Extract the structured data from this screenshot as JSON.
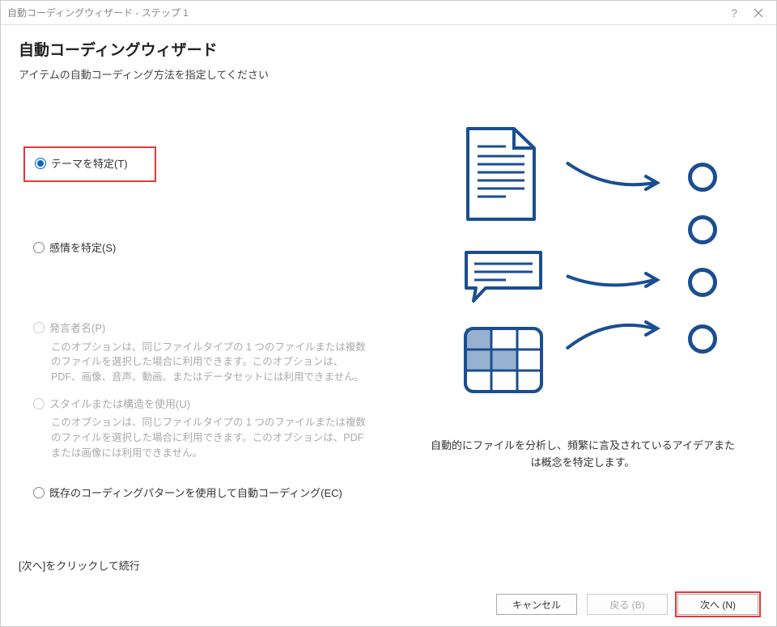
{
  "titlebar": {
    "title": "自動コーディングウィザード - ステップ 1"
  },
  "header": {
    "title": "自動コーディングウィザード",
    "subtitle": "アイテムの自動コーディング方法を指定してください"
  },
  "options": {
    "theme": "テーマを特定(T)",
    "sentiment": "感情を特定(S)",
    "speaker": "発言者名(P)",
    "speaker_desc": "このオプションは、同じファイルタイプの 1 つのファイルまたは複数のファイルを選択した場合に利用できます。このオプションは、PDF、画像、音声、動画、またはデータセットには利用できません。",
    "style": "スタイルまたは構造を使用(U)",
    "style_desc": "このオプションは、同じファイルタイプの 1 つのファイルまたは複数のファイルを選択した場合に利用できます。このオプションは、PDFまたは画像には利用できません。",
    "existing": "既存のコーディングパターンを使用して自動コーディング(EC)"
  },
  "illustration": {
    "caption": "自動的にファイルを分析し、頻繁に言及されているアイデアまたは概念を特定します。"
  },
  "footer": {
    "hint": "[次へ]をクリックして続行"
  },
  "buttons": {
    "cancel": "キャンセル",
    "back": "戻る (B)",
    "next": "次へ (N)"
  }
}
